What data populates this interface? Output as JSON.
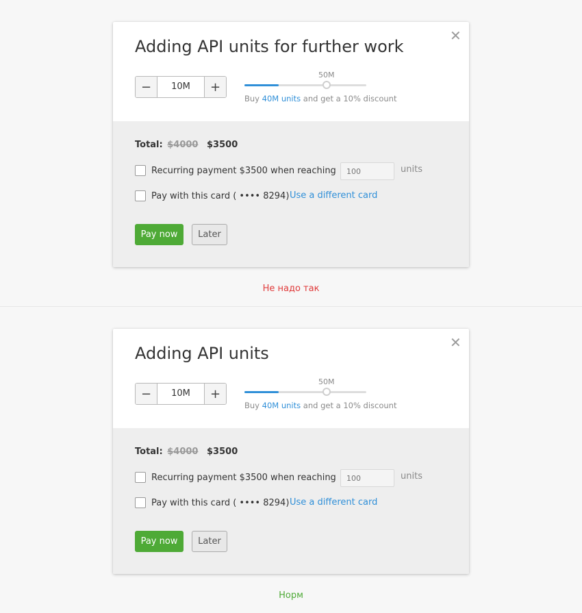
{
  "examples": [
    {
      "title": "Adding API units for further work",
      "close_symbol": "✕",
      "stepper": {
        "minus": "−",
        "value": "10M",
        "plus": "+"
      },
      "slider": {
        "label": "50M",
        "fill_fraction": 0.28
      },
      "hint": {
        "prefix": "Buy ",
        "link": "40M units",
        "suffix": " and get a 10% discount"
      },
      "total": {
        "label": "Total:",
        "old_price": "$4000",
        "new_price": "$3500"
      },
      "recurring": {
        "label": "Recurring payment $3500 when reaching",
        "placeholder": "100",
        "units": "units"
      },
      "card": {
        "label": "Pay with this card ( •••• 8294)",
        "link": "Use a different card"
      },
      "pay_label": "Pay now",
      "later_label": "Later",
      "caption": "Не надо так",
      "caption_color": "#e03a3a"
    },
    {
      "title": "Adding API units",
      "close_symbol": "✕",
      "stepper": {
        "minus": "−",
        "value": "10M",
        "plus": "+"
      },
      "slider": {
        "label": "50M",
        "fill_fraction": 0.28
      },
      "hint": {
        "prefix": "Buy ",
        "link": "40M units",
        "suffix": " and get a 10% discount"
      },
      "total": {
        "label": "Total:",
        "old_price": "$4000",
        "new_price": "$3500"
      },
      "recurring": {
        "label": "Recurring payment $3500 when reaching",
        "placeholder": "100",
        "units": "units"
      },
      "card": {
        "label": "Pay with this card ( •••• 8294)",
        "link": "Use a different card"
      },
      "pay_label": "Pay now",
      "later_label": "Later",
      "caption": "Норм",
      "caption_color": "#4eaa36"
    }
  ],
  "colors": {
    "accent": "#2f8fd8",
    "pay_button": "#4eaa36",
    "bad": "#e03a3a",
    "good": "#4eaa36"
  }
}
